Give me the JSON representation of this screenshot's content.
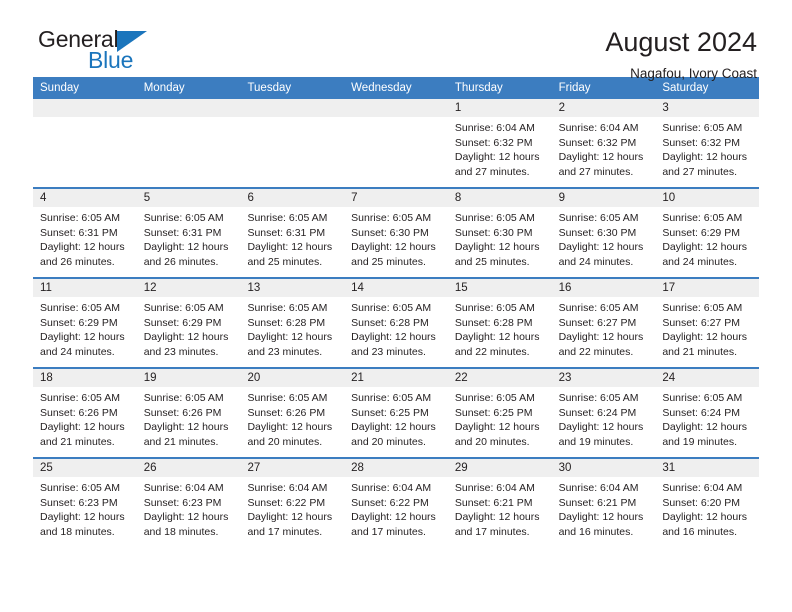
{
  "brand": {
    "word_one": "General",
    "word_two": "Blue",
    "triangle_icon": "triangle-logo-icon",
    "accent_color": "#1b75bc"
  },
  "header": {
    "title": "August 2024",
    "subtitle": "Nagafou, Ivory Coast"
  },
  "theme": {
    "header_row_bg": "#3c7dc0",
    "day_header_bg": "#efefef",
    "text_color": "#231f20"
  },
  "calendar": {
    "weekday_headers": [
      "Sunday",
      "Monday",
      "Tuesday",
      "Wednesday",
      "Thursday",
      "Friday",
      "Saturday"
    ],
    "weeks": [
      [
        {
          "day": "",
          "empty": true,
          "sunrise": "",
          "sunset": "",
          "daylight_line1": "",
          "daylight_line2": ""
        },
        {
          "day": "",
          "empty": true,
          "sunrise": "",
          "sunset": "",
          "daylight_line1": "",
          "daylight_line2": ""
        },
        {
          "day": "",
          "empty": true,
          "sunrise": "",
          "sunset": "",
          "daylight_line1": "",
          "daylight_line2": ""
        },
        {
          "day": "",
          "empty": true,
          "sunrise": "",
          "sunset": "",
          "daylight_line1": "",
          "daylight_line2": ""
        },
        {
          "day": "1",
          "empty": false,
          "sunrise": "Sunrise: 6:04 AM",
          "sunset": "Sunset: 6:32 PM",
          "daylight_line1": "Daylight: 12 hours",
          "daylight_line2": "and 27 minutes."
        },
        {
          "day": "2",
          "empty": false,
          "sunrise": "Sunrise: 6:04 AM",
          "sunset": "Sunset: 6:32 PM",
          "daylight_line1": "Daylight: 12 hours",
          "daylight_line2": "and 27 minutes."
        },
        {
          "day": "3",
          "empty": false,
          "sunrise": "Sunrise: 6:05 AM",
          "sunset": "Sunset: 6:32 PM",
          "daylight_line1": "Daylight: 12 hours",
          "daylight_line2": "and 27 minutes."
        }
      ],
      [
        {
          "day": "4",
          "empty": false,
          "sunrise": "Sunrise: 6:05 AM",
          "sunset": "Sunset: 6:31 PM",
          "daylight_line1": "Daylight: 12 hours",
          "daylight_line2": "and 26 minutes."
        },
        {
          "day": "5",
          "empty": false,
          "sunrise": "Sunrise: 6:05 AM",
          "sunset": "Sunset: 6:31 PM",
          "daylight_line1": "Daylight: 12 hours",
          "daylight_line2": "and 26 minutes."
        },
        {
          "day": "6",
          "empty": false,
          "sunrise": "Sunrise: 6:05 AM",
          "sunset": "Sunset: 6:31 PM",
          "daylight_line1": "Daylight: 12 hours",
          "daylight_line2": "and 25 minutes."
        },
        {
          "day": "7",
          "empty": false,
          "sunrise": "Sunrise: 6:05 AM",
          "sunset": "Sunset: 6:30 PM",
          "daylight_line1": "Daylight: 12 hours",
          "daylight_line2": "and 25 minutes."
        },
        {
          "day": "8",
          "empty": false,
          "sunrise": "Sunrise: 6:05 AM",
          "sunset": "Sunset: 6:30 PM",
          "daylight_line1": "Daylight: 12 hours",
          "daylight_line2": "and 25 minutes."
        },
        {
          "day": "9",
          "empty": false,
          "sunrise": "Sunrise: 6:05 AM",
          "sunset": "Sunset: 6:30 PM",
          "daylight_line1": "Daylight: 12 hours",
          "daylight_line2": "and 24 minutes."
        },
        {
          "day": "10",
          "empty": false,
          "sunrise": "Sunrise: 6:05 AM",
          "sunset": "Sunset: 6:29 PM",
          "daylight_line1": "Daylight: 12 hours",
          "daylight_line2": "and 24 minutes."
        }
      ],
      [
        {
          "day": "11",
          "empty": false,
          "sunrise": "Sunrise: 6:05 AM",
          "sunset": "Sunset: 6:29 PM",
          "daylight_line1": "Daylight: 12 hours",
          "daylight_line2": "and 24 minutes."
        },
        {
          "day": "12",
          "empty": false,
          "sunrise": "Sunrise: 6:05 AM",
          "sunset": "Sunset: 6:29 PM",
          "daylight_line1": "Daylight: 12 hours",
          "daylight_line2": "and 23 minutes."
        },
        {
          "day": "13",
          "empty": false,
          "sunrise": "Sunrise: 6:05 AM",
          "sunset": "Sunset: 6:28 PM",
          "daylight_line1": "Daylight: 12 hours",
          "daylight_line2": "and 23 minutes."
        },
        {
          "day": "14",
          "empty": false,
          "sunrise": "Sunrise: 6:05 AM",
          "sunset": "Sunset: 6:28 PM",
          "daylight_line1": "Daylight: 12 hours",
          "daylight_line2": "and 23 minutes."
        },
        {
          "day": "15",
          "empty": false,
          "sunrise": "Sunrise: 6:05 AM",
          "sunset": "Sunset: 6:28 PM",
          "daylight_line1": "Daylight: 12 hours",
          "daylight_line2": "and 22 minutes."
        },
        {
          "day": "16",
          "empty": false,
          "sunrise": "Sunrise: 6:05 AM",
          "sunset": "Sunset: 6:27 PM",
          "daylight_line1": "Daylight: 12 hours",
          "daylight_line2": "and 22 minutes."
        },
        {
          "day": "17",
          "empty": false,
          "sunrise": "Sunrise: 6:05 AM",
          "sunset": "Sunset: 6:27 PM",
          "daylight_line1": "Daylight: 12 hours",
          "daylight_line2": "and 21 minutes."
        }
      ],
      [
        {
          "day": "18",
          "empty": false,
          "sunrise": "Sunrise: 6:05 AM",
          "sunset": "Sunset: 6:26 PM",
          "daylight_line1": "Daylight: 12 hours",
          "daylight_line2": "and 21 minutes."
        },
        {
          "day": "19",
          "empty": false,
          "sunrise": "Sunrise: 6:05 AM",
          "sunset": "Sunset: 6:26 PM",
          "daylight_line1": "Daylight: 12 hours",
          "daylight_line2": "and 21 minutes."
        },
        {
          "day": "20",
          "empty": false,
          "sunrise": "Sunrise: 6:05 AM",
          "sunset": "Sunset: 6:26 PM",
          "daylight_line1": "Daylight: 12 hours",
          "daylight_line2": "and 20 minutes."
        },
        {
          "day": "21",
          "empty": false,
          "sunrise": "Sunrise: 6:05 AM",
          "sunset": "Sunset: 6:25 PM",
          "daylight_line1": "Daylight: 12 hours",
          "daylight_line2": "and 20 minutes."
        },
        {
          "day": "22",
          "empty": false,
          "sunrise": "Sunrise: 6:05 AM",
          "sunset": "Sunset: 6:25 PM",
          "daylight_line1": "Daylight: 12 hours",
          "daylight_line2": "and 20 minutes."
        },
        {
          "day": "23",
          "empty": false,
          "sunrise": "Sunrise: 6:05 AM",
          "sunset": "Sunset: 6:24 PM",
          "daylight_line1": "Daylight: 12 hours",
          "daylight_line2": "and 19 minutes."
        },
        {
          "day": "24",
          "empty": false,
          "sunrise": "Sunrise: 6:05 AM",
          "sunset": "Sunset: 6:24 PM",
          "daylight_line1": "Daylight: 12 hours",
          "daylight_line2": "and 19 minutes."
        }
      ],
      [
        {
          "day": "25",
          "empty": false,
          "sunrise": "Sunrise: 6:05 AM",
          "sunset": "Sunset: 6:23 PM",
          "daylight_line1": "Daylight: 12 hours",
          "daylight_line2": "and 18 minutes."
        },
        {
          "day": "26",
          "empty": false,
          "sunrise": "Sunrise: 6:04 AM",
          "sunset": "Sunset: 6:23 PM",
          "daylight_line1": "Daylight: 12 hours",
          "daylight_line2": "and 18 minutes."
        },
        {
          "day": "27",
          "empty": false,
          "sunrise": "Sunrise: 6:04 AM",
          "sunset": "Sunset: 6:22 PM",
          "daylight_line1": "Daylight: 12 hours",
          "daylight_line2": "and 17 minutes."
        },
        {
          "day": "28",
          "empty": false,
          "sunrise": "Sunrise: 6:04 AM",
          "sunset": "Sunset: 6:22 PM",
          "daylight_line1": "Daylight: 12 hours",
          "daylight_line2": "and 17 minutes."
        },
        {
          "day": "29",
          "empty": false,
          "sunrise": "Sunrise: 6:04 AM",
          "sunset": "Sunset: 6:21 PM",
          "daylight_line1": "Daylight: 12 hours",
          "daylight_line2": "and 17 minutes."
        },
        {
          "day": "30",
          "empty": false,
          "sunrise": "Sunrise: 6:04 AM",
          "sunset": "Sunset: 6:21 PM",
          "daylight_line1": "Daylight: 12 hours",
          "daylight_line2": "and 16 minutes."
        },
        {
          "day": "31",
          "empty": false,
          "sunrise": "Sunrise: 6:04 AM",
          "sunset": "Sunset: 6:20 PM",
          "daylight_line1": "Daylight: 12 hours",
          "daylight_line2": "and 16 minutes."
        }
      ]
    ]
  }
}
